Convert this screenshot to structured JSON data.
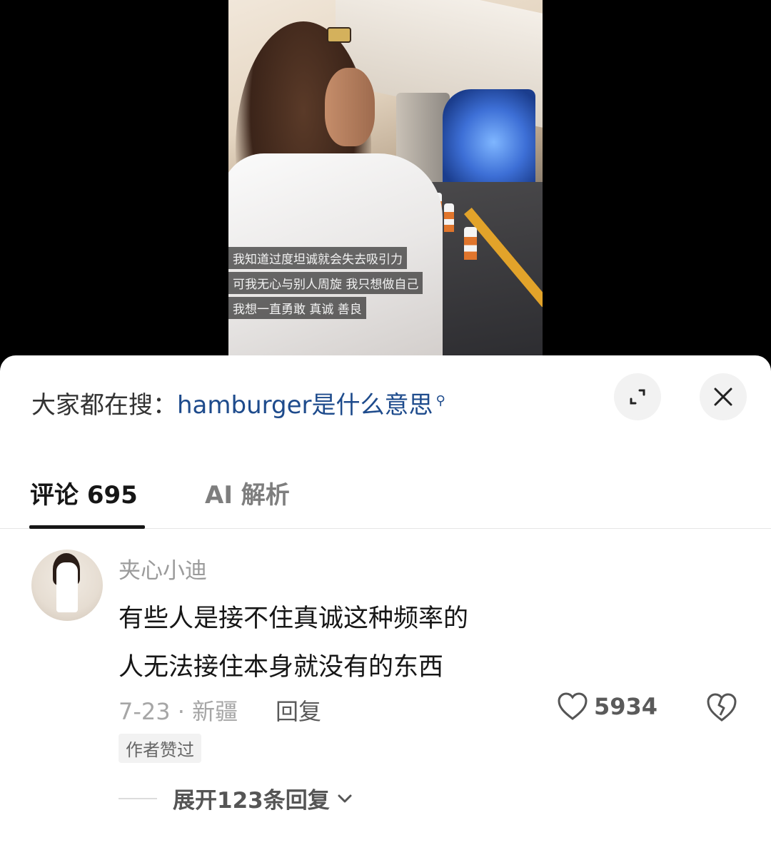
{
  "video": {
    "subtitles": [
      "我知道过度坦诚就会失去吸引力",
      "可我无心与别人周旋  我只想做自己",
      "我想一直勇敢 真诚 善良"
    ]
  },
  "search": {
    "prefix": "大家都在搜：",
    "query": "hamburger是什么意思"
  },
  "tabs": {
    "comments_label": "评论",
    "comments_count": "695",
    "ai_label": "AI 解析"
  },
  "comment": {
    "username": "夹心小迪",
    "lines": [
      "有些人是接不住真诚这种频率的",
      "人无法接住本身就没有的东西"
    ],
    "date_location": "7-23 · 新疆",
    "reply_label": "回复",
    "like_count": "5934",
    "badge": "作者赞过",
    "expand_label": "展开123条回复"
  }
}
